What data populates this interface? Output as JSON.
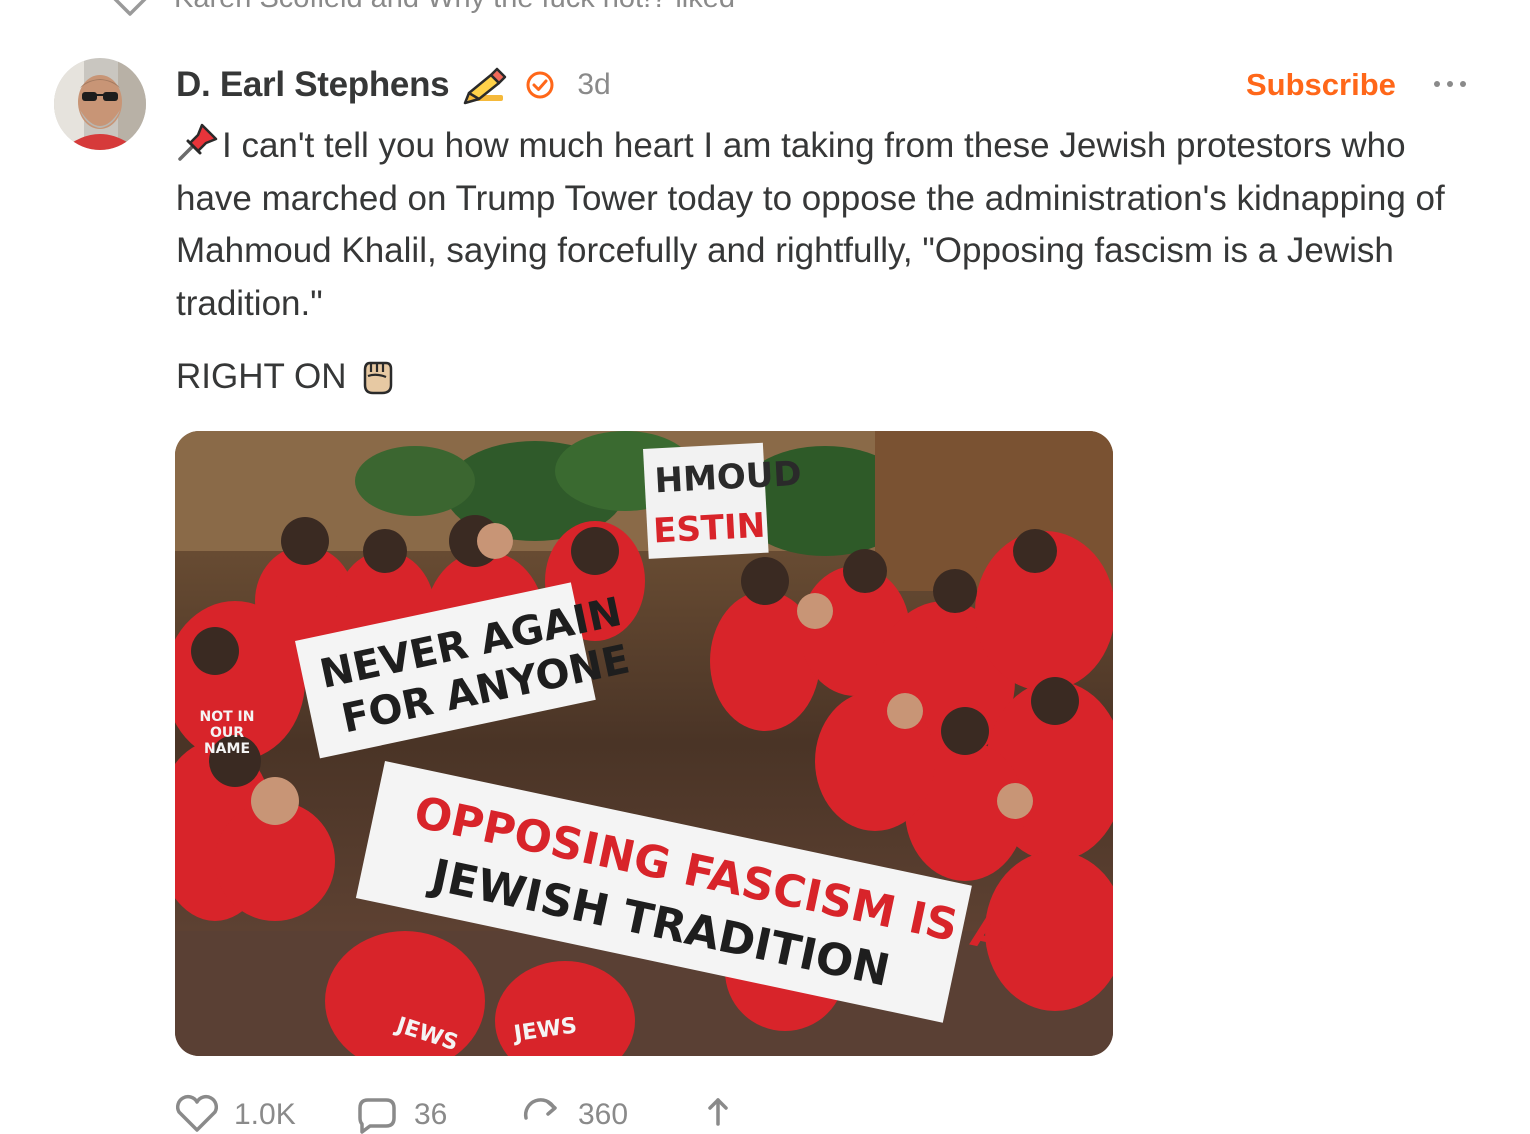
{
  "liked_by": {
    "text": "Karen Scofield and Why the fuck not!? liked"
  },
  "post": {
    "author": {
      "name": "D. Earl Stephens",
      "name_emoji": "writing-hand-emoji",
      "verified_icon": "check-circle-icon"
    },
    "timestamp": "3d",
    "subscribe_label": "Subscribe",
    "more_icon": "ellipsis-icon",
    "body_text": "I can't tell you how much heart I am taking from these Jewish protestors who have marched on Trump Tower today to oppose the administration's kidnapping of Mahmoud Khalil, saying forcefully and rightfully, \"Opposing fascism is a Jewish tradition.\"",
    "body_icon": "pushpin-emoji",
    "closing_text": "RIGHT ON",
    "closing_icon": "raised-fist-emoji",
    "image": {
      "description_icon": "protest-photo",
      "banner_1": [
        "NEVER AGAIN",
        "FOR ANYONE"
      ],
      "banner_2": [
        "OPPOSING FASCISM IS A",
        "JEWISH TRADITION"
      ],
      "banner_3": [
        "HMOUD",
        "ESTIN"
      ],
      "shirt_text": [
        "NOT IN",
        "OUR",
        "NAME"
      ],
      "shirt_text_2": "JEWS"
    },
    "actions": {
      "likes": "1.0K",
      "comments": "36",
      "restacks": "360"
    }
  },
  "colors": {
    "accent": "#ff6719",
    "text": "#363737",
    "muted": "#8a8a8a",
    "shirt_red": "#d8242a"
  }
}
